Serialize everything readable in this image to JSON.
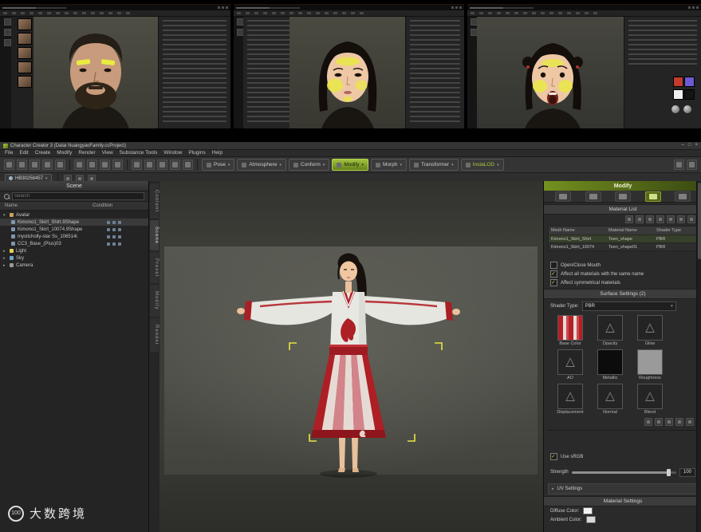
{
  "colors": {
    "accent_green": "#9dbd3a",
    "selection_yellow": "#e8e546",
    "skirt_red": "#b01f25"
  },
  "icons": {
    "warning": "△"
  },
  "top_shots": {
    "swatches": [
      "#c23b2e",
      "#6b5bd4",
      "#efefef",
      "#141414"
    ]
  },
  "app": {
    "titlebar": {
      "title": "Character Creator 3 (Dalai NuangyaoFamily.ccProject)",
      "minimize": "–",
      "maximize": "□",
      "close": "×"
    },
    "menus": [
      "File",
      "Edit",
      "Create",
      "Modify",
      "Render",
      "View",
      "Substance Tools",
      "Window",
      "Plugins",
      "Help"
    ],
    "toolbar_chips": [
      {
        "label": "Pose"
      },
      {
        "label": "Atmosphere"
      },
      {
        "label": "Conform"
      },
      {
        "label": "Modify"
      },
      {
        "label": "Morph"
      },
      {
        "label": "Transformer"
      },
      {
        "label": "InstaLOD"
      }
    ],
    "avatar_chip": "HB30258457",
    "side_tabs": [
      "Content",
      "Scene",
      "Preset",
      "Modify",
      "Render"
    ],
    "scene": {
      "title": "Scene",
      "search_placeholder": "Search",
      "col_name": "Name",
      "col_condition": "Condition",
      "tree": [
        {
          "label": "Avatar"
        },
        {
          "label": "Kimono1_Skirt_Shirt.9Shape"
        },
        {
          "label": "Kimono1_Skirt_10074.9Shape"
        },
        {
          "label": "mysticholly-star Ss_106514i"
        },
        {
          "label": "CC3_Base_(Plus)03"
        },
        {
          "label": "Light"
        },
        {
          "label": "Sky"
        },
        {
          "label": "Camera"
        }
      ]
    },
    "modify": {
      "title": "Modify",
      "material_list_title": "Material List",
      "table": {
        "h_mesh": "Mesh Name",
        "h_material": "Material Name",
        "h_shader": "Shader Type",
        "rows": [
          {
            "mesh": "Kimono1_Skirt_Shirt",
            "material": "Teen_shape",
            "shader": "PBR"
          },
          {
            "mesh": "Kimono1_Skirt_10074",
            "material": "Teen_shape01",
            "shader": "PBR"
          }
        ]
      },
      "options": [
        {
          "label": "Open/Close Mouth",
          "checked": false
        },
        {
          "label": "Affect all materials with the same name",
          "checked": true
        },
        {
          "label": "Affect symmetrical materials",
          "checked": true
        }
      ],
      "surface_title": "Surface Settings (2)",
      "shader_label": "Shader Type:",
      "shader_value": "PBR",
      "channels": [
        "Base Color",
        "Opacity",
        "Glow",
        "AO",
        "Metallic",
        "Roughness",
        "Displacement",
        "Normal",
        "Blend"
      ],
      "use_srgb": "Use sRGB",
      "strength_label": "Strength",
      "strength_value": "100",
      "uv_settings": "UV Settings",
      "material_settings_title": "Material Settings",
      "diffuse_label": "Diffuse Color:",
      "ambient_label": "Ambient Color:"
    }
  },
  "watermark": {
    "logo": "100",
    "text": "大数跨境"
  }
}
